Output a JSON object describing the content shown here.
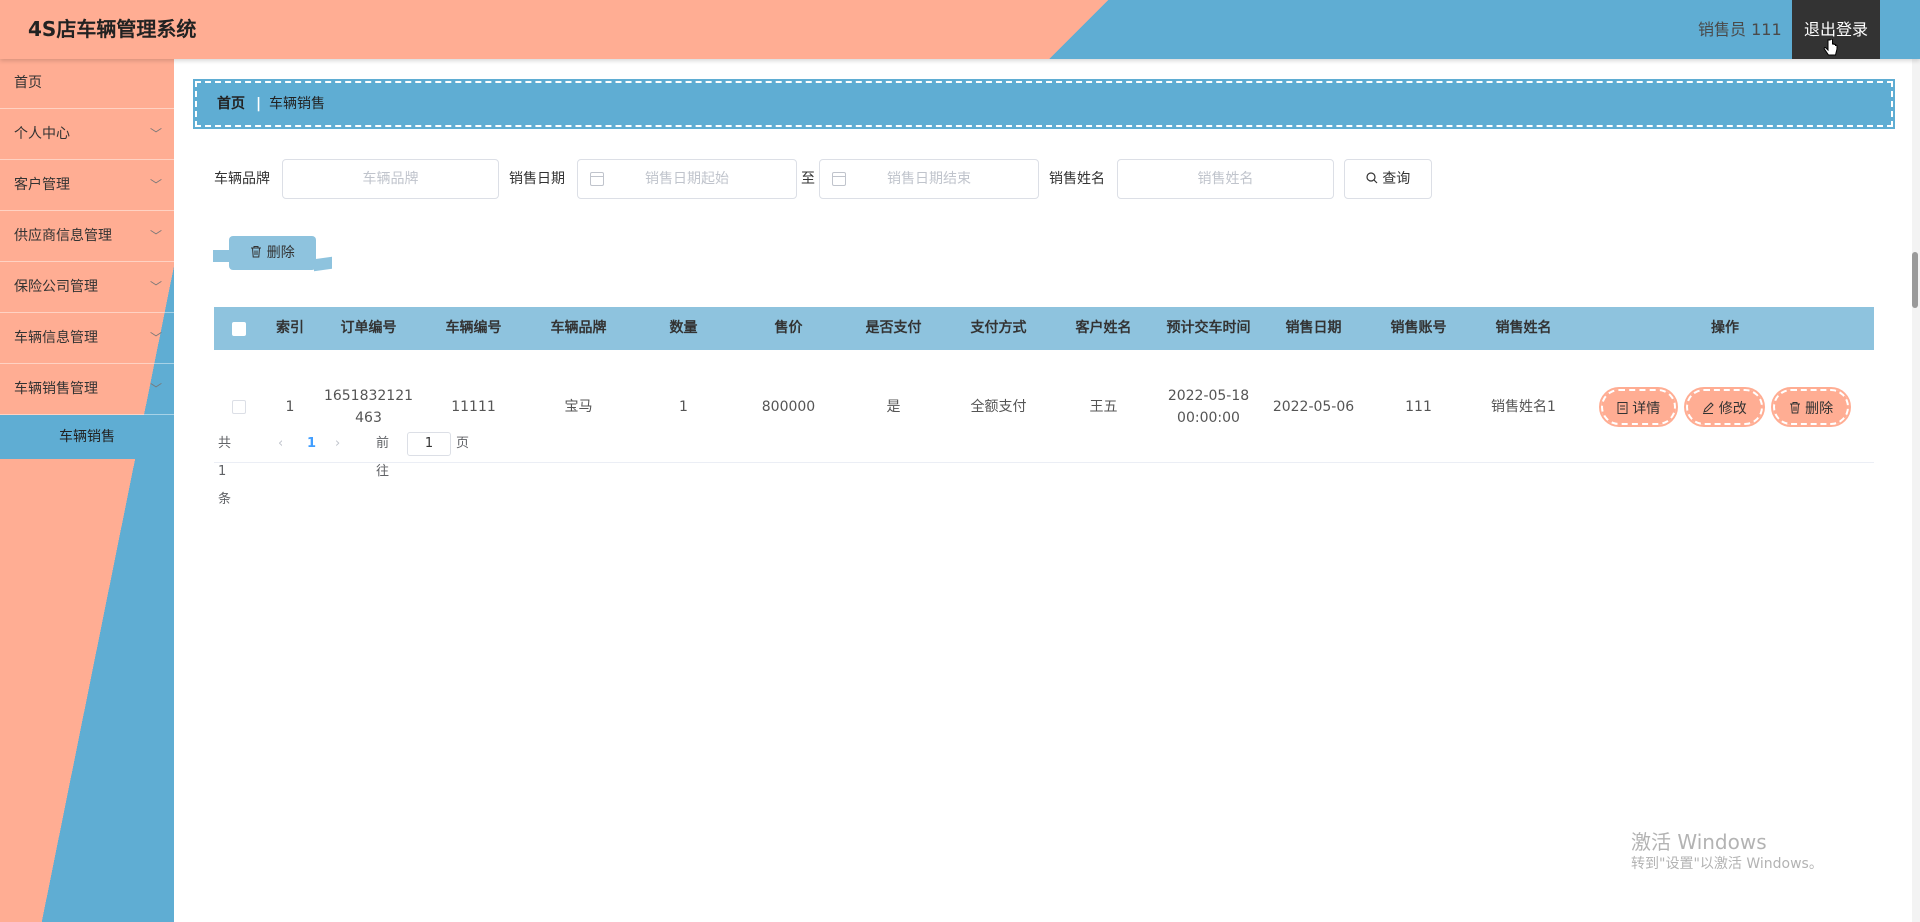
{
  "header": {
    "title": "4S店车辆管理系统",
    "user": "销售员 111",
    "logout_label": "退出登录"
  },
  "sidebar": {
    "items": [
      {
        "label": "首页"
      },
      {
        "label": "个人中心"
      },
      {
        "label": "客户管理"
      },
      {
        "label": "供应商信息管理"
      },
      {
        "label": "保险公司管理"
      },
      {
        "label": "车辆信息管理"
      },
      {
        "label": "车辆销售管理"
      }
    ],
    "active_sub": "车辆销售"
  },
  "breadcrumb": {
    "home": "首页",
    "separator": "|",
    "current": "车辆销售"
  },
  "search": {
    "brand_label": "车辆品牌",
    "brand_placeholder": "车辆品牌",
    "date_label": "销售日期",
    "date_start_placeholder": "销售日期起始",
    "range_separator": "至",
    "date_end_placeholder": "销售日期结束",
    "seller_label": "销售姓名",
    "seller_placeholder": "销售姓名",
    "query_label": "查询"
  },
  "toolbar": {
    "delete_label": "删除"
  },
  "table": {
    "headers": [
      "索引",
      "订单编号",
      "车辆编号",
      "车辆品牌",
      "数量",
      "售价",
      "是否支付",
      "支付方式",
      "客户姓名",
      "预计交车时间",
      "销售日期",
      "销售账号",
      "销售姓名",
      "操作"
    ],
    "rows": [
      {
        "index": "1",
        "order_no_l1": "1651832121",
        "order_no_l2": "463",
        "vehicle_no": "11111",
        "brand": "宝马",
        "quantity": "1",
        "price": "800000",
        "paid": "是",
        "pay_method": "全额支付",
        "customer": "王五",
        "delivery_date": "2022-05-18",
        "delivery_time": "00:00:00",
        "sale_date": "2022-05-06",
        "sale_account": "111",
        "seller_name": "销售姓名1",
        "actions": {
          "detail": "详情",
          "edit": "修改",
          "delete": "删除"
        }
      }
    ]
  },
  "pagination": {
    "total": "共 1 条",
    "prev": "‹",
    "current_page": "1",
    "next": "›",
    "goto_label": "前往",
    "goto_value": "1",
    "page_suffix": "页"
  },
  "watermark": {
    "title": "激活 Windows",
    "subtitle": "转到\"设置\"以激活 Windows。"
  },
  "colors": {
    "peach": "#ffad93",
    "blue": "#5fadd3",
    "light_blue": "#8ec3de",
    "dark": "#333333"
  },
  "icons": [
    "calendar-icon",
    "search-icon",
    "trash-icon",
    "document-icon",
    "edit-icon",
    "chevron-down-icon",
    "hand-cursor-icon"
  ]
}
